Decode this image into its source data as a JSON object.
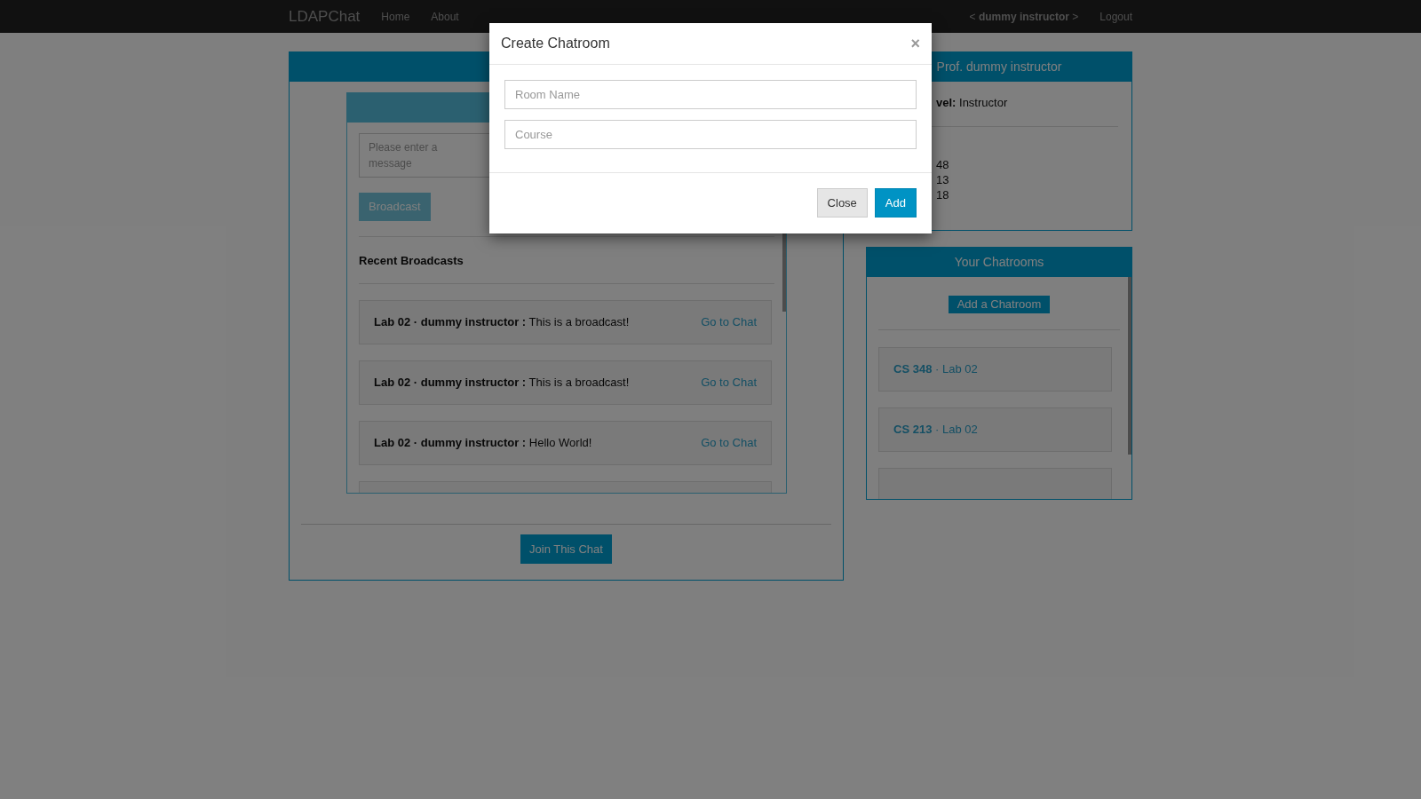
{
  "navbar": {
    "brand": "LDAPChat",
    "links": [
      "Home",
      "About"
    ],
    "user": "< **dummy instructor** >",
    "logout": "Logout"
  },
  "broadcast_panel": {
    "message_placeholder": "Please enter a message",
    "button": "Broadcast",
    "recent_title": "Recent Broadcasts",
    "items": [
      {
        "source": "Lab 02 · dummy instructor :",
        "text": "This is a broadcast!",
        "link": "Go to Chat"
      },
      {
        "source": "Lab 02 · dummy instructor :",
        "text": "This is a broadcast!",
        "link": "Go to Chat"
      },
      {
        "source": "Lab 02 · dummy instructor :",
        "text": "Hello World!",
        "link": "Go to Chat"
      }
    ],
    "join_button": "Join This Chat"
  },
  "profile": {
    "header": "Prof. dummy instructor",
    "level_label": "vel:",
    "level_value": "Instructor",
    "courses": [
      "48",
      "13",
      "18"
    ]
  },
  "chatrooms": {
    "title": "Your Chatrooms",
    "add_button": "Add a Chatroom",
    "rooms": [
      {
        "label": "**CS 348** · Lab 02"
      },
      {
        "label": "**CS 213** · Lab 02"
      }
    ]
  },
  "modal": {
    "title": "Create Chatroom",
    "close": "×",
    "fields": [
      {
        "placeholder": "Room Name"
      },
      {
        "placeholder": "Course"
      }
    ],
    "buttons": [
      {
        "label": "Close",
        "kind": "default"
      },
      {
        "label": "Add",
        "kind": "primary"
      }
    ]
  }
}
